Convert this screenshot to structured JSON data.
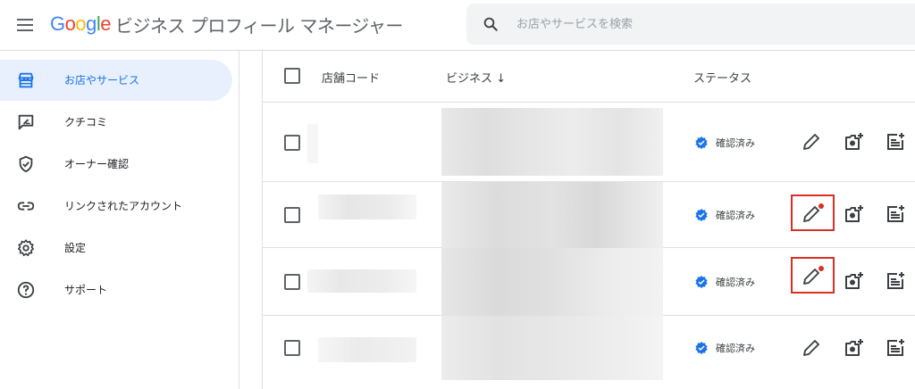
{
  "app": {
    "logo_letters": [
      {
        "ch": "G",
        "color": "#4285F4"
      },
      {
        "ch": "o",
        "color": "#EA4335"
      },
      {
        "ch": "o",
        "color": "#FBBC05"
      },
      {
        "ch": "g",
        "color": "#4285F4"
      },
      {
        "ch": "l",
        "color": "#34A853"
      },
      {
        "ch": "e",
        "color": "#EA4335"
      }
    ],
    "product_name": "ビジネス プロフィール マネージャー"
  },
  "search": {
    "placeholder": "お店やサービスを検索",
    "value": ""
  },
  "sidebar": {
    "items": [
      {
        "label": "お店やサービス",
        "icon": "store-icon",
        "active": true
      },
      {
        "label": "クチコミ",
        "icon": "review-icon",
        "active": false
      },
      {
        "label": "オーナー確認",
        "icon": "verified-shield-icon",
        "active": false
      },
      {
        "label": "リンクされたアカウント",
        "icon": "link-icon",
        "active": false
      },
      {
        "label": "設定",
        "icon": "gear-icon",
        "active": false
      },
      {
        "label": "サポート",
        "icon": "help-icon",
        "active": false
      }
    ]
  },
  "table": {
    "headers": {
      "code": "店舗コード",
      "business": "ビジネス",
      "business_sort": "↓",
      "status": "ステータス"
    },
    "rows": [
      {
        "status": "確認済み",
        "edit_flagged": false
      },
      {
        "status": "確認済み",
        "edit_flagged": true
      },
      {
        "status": "確認済み",
        "edit_flagged": true
      },
      {
        "status": "確認済み",
        "edit_flagged": false
      }
    ]
  },
  "colors": {
    "accent": "#1a73e8",
    "active_bg": "#e8f0fe",
    "verified": "#1a73e8",
    "highlight": "#d93025",
    "icon_gray": "#5f6368"
  }
}
